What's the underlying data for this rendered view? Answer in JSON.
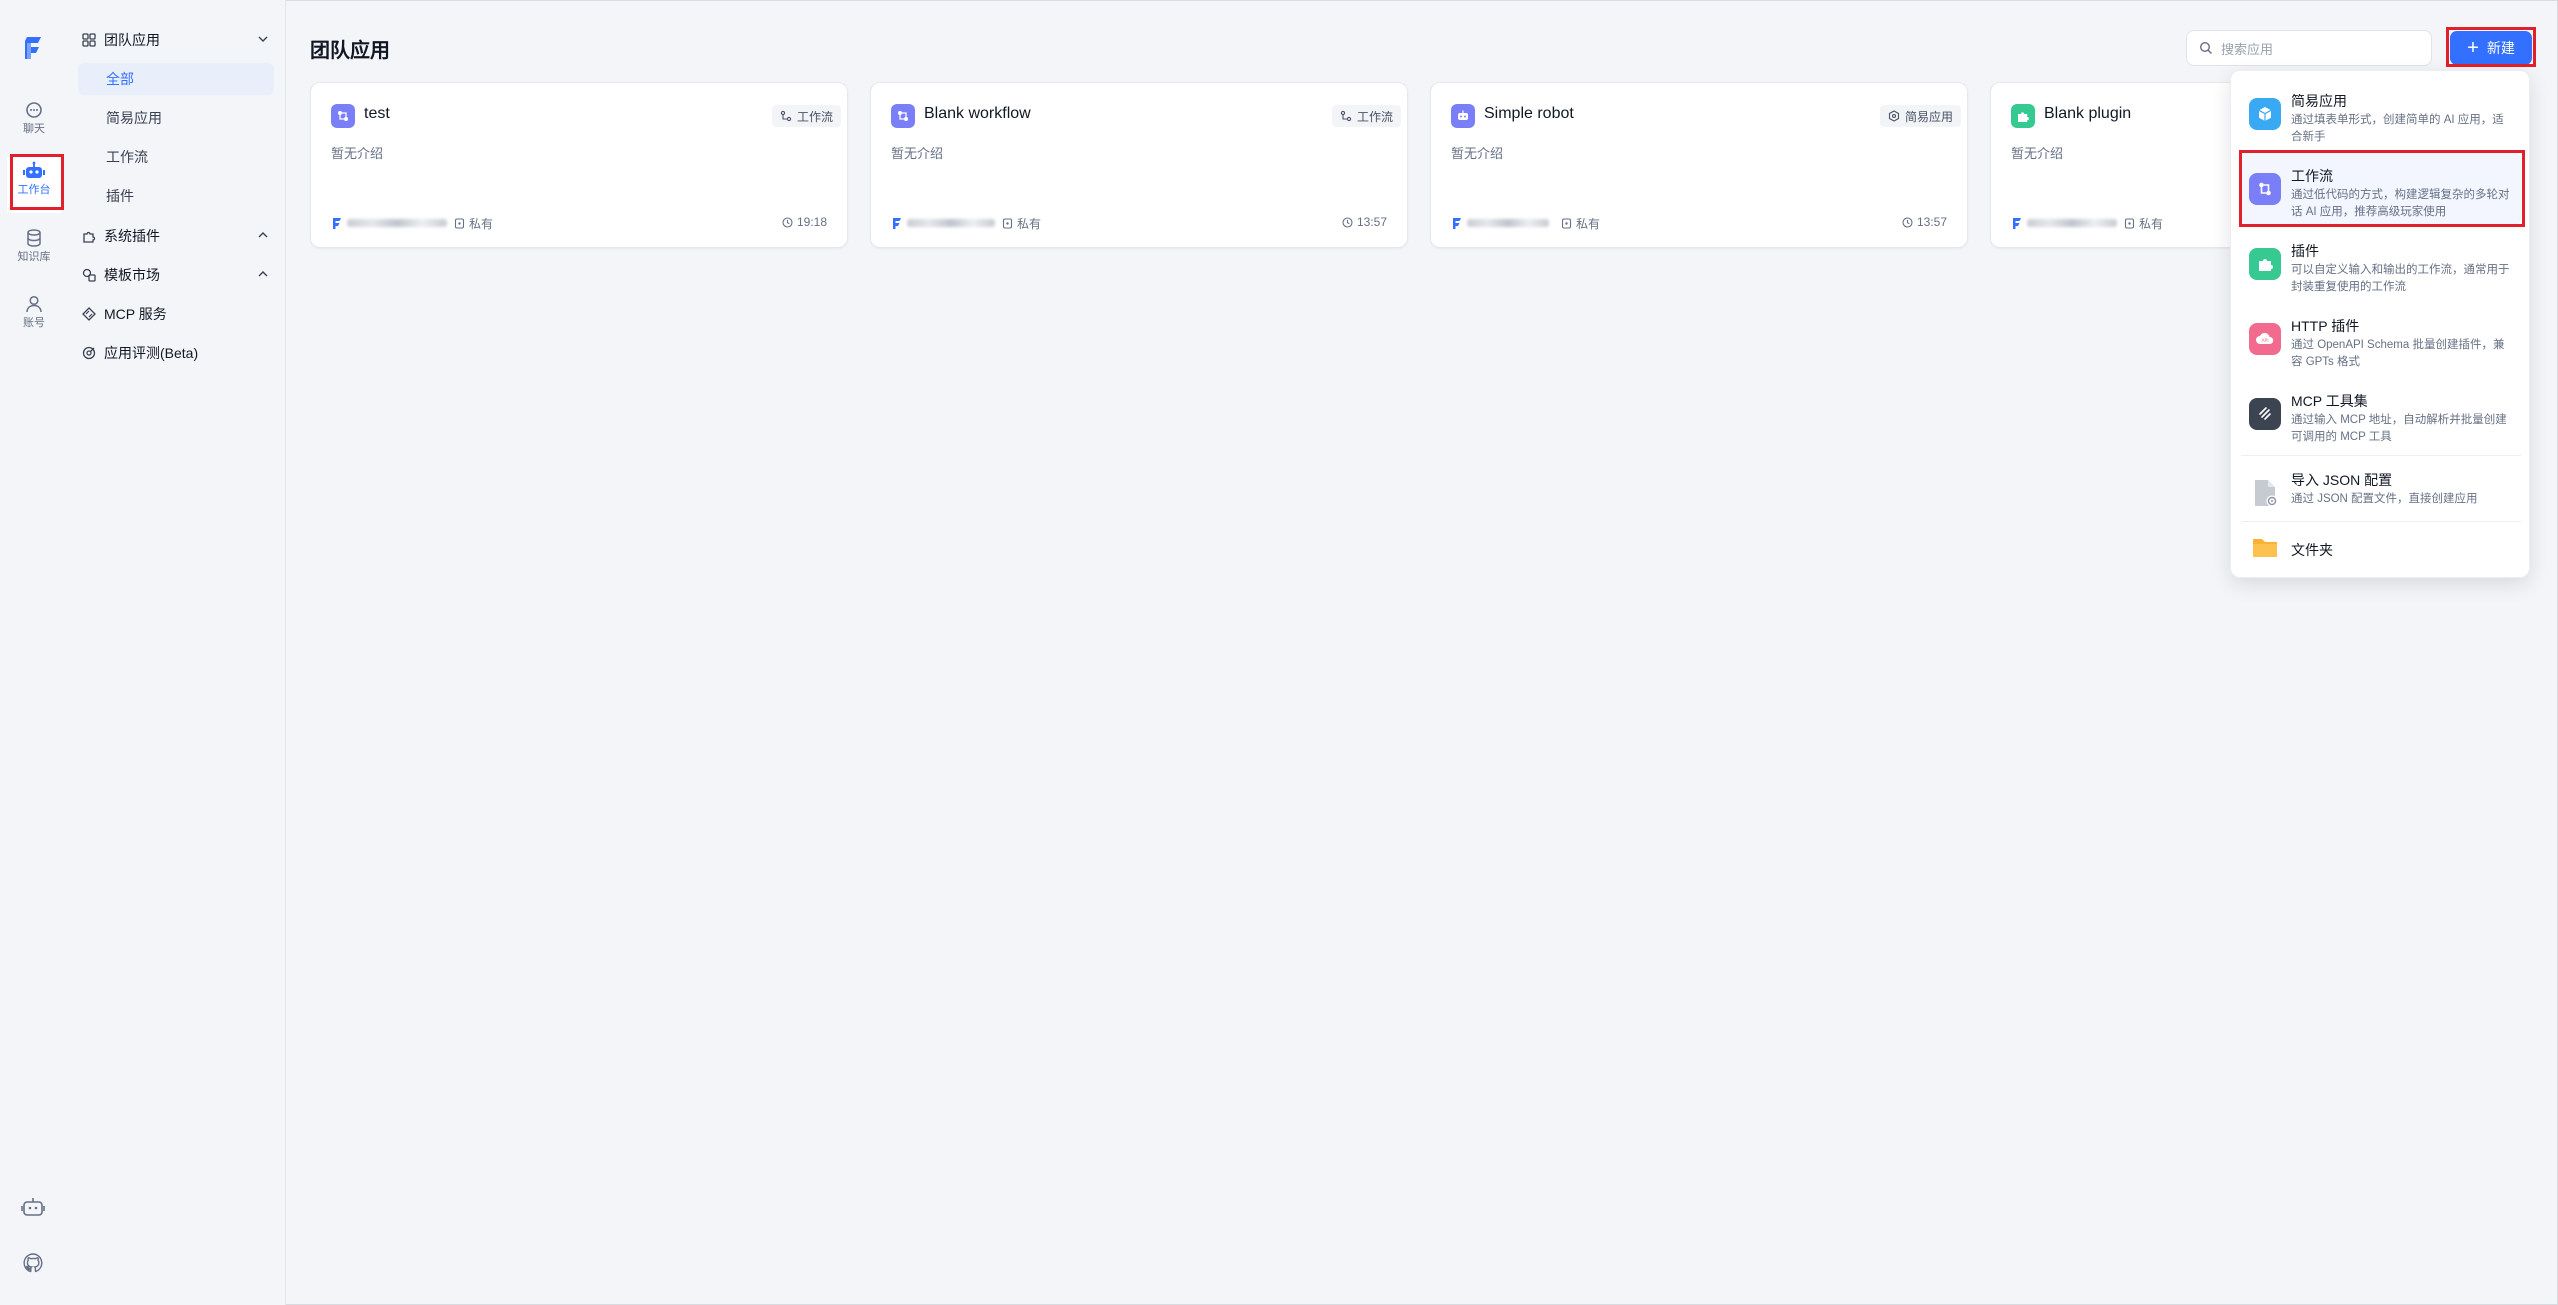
{
  "rail": {
    "items": [
      {
        "label": "聊天"
      },
      {
        "label": "工作台"
      },
      {
        "label": "知识库"
      },
      {
        "label": "账号"
      }
    ]
  },
  "sidebar": {
    "team_apps": "团队应用",
    "sub_items": [
      "全部",
      "简易应用",
      "工作流",
      "插件"
    ],
    "system_plugins": "系统插件",
    "template_market": "模板市场",
    "mcp_service": "MCP 服务",
    "app_eval": "应用评测(Beta)"
  },
  "main": {
    "title": "团队应用",
    "search_placeholder": "搜索应用",
    "new_button": "新建",
    "cards": [
      {
        "name": "test",
        "tag": "工作流",
        "desc": "暂无介绍",
        "visibility": "私有",
        "time": "19:18",
        "icon_color": "#7b7ff7"
      },
      {
        "name": "Blank workflow",
        "tag": "工作流",
        "desc": "暂无介绍",
        "visibility": "私有",
        "time": "13:57",
        "icon_color": "#7b7ff7"
      },
      {
        "name": "Simple robot",
        "tag": "简易应用",
        "desc": "暂无介绍",
        "visibility": "私有",
        "time": "13:57",
        "icon_color": "#7b7ff7"
      },
      {
        "name": "Blank plugin",
        "tag": "",
        "desc": "暂无介绍",
        "visibility": "私有",
        "time": "",
        "icon_color": "#36c992"
      }
    ]
  },
  "menu": {
    "items": [
      {
        "title": "简易应用",
        "desc": "通过填表单形式，创建简单的 AI 应用，适合新手",
        "icon_color": "#38a9f2"
      },
      {
        "title": "工作流",
        "desc": "通过低代码的方式，构建逻辑复杂的多轮对话 AI 应用，推荐高级玩家使用",
        "icon_color": "#7b7ff7"
      },
      {
        "title": "插件",
        "desc": "可以自定义输入和输出的工作流，通常用于封装重复使用的工作流",
        "icon_color": "#36c992"
      },
      {
        "title": "HTTP 插件",
        "desc": "通过 OpenAPI Schema 批量创建插件，兼容 GPTs 格式",
        "icon_color": "#f26a8d"
      },
      {
        "title": "MCP 工具集",
        "desc": "通过输入 MCP 地址，自动解析并批量创建可调用的 MCP 工具",
        "icon_color": "#3d4451"
      },
      {
        "title": "导入 JSON 配置",
        "desc": "通过 JSON 配置文件，直接创建应用",
        "icon_color": "#c5cad3"
      },
      {
        "title": "文件夹",
        "desc": "",
        "icon_color": "#f9b233"
      }
    ]
  },
  "colors": {
    "accent": "#3370ff",
    "highlight_box": "#e0202a"
  }
}
